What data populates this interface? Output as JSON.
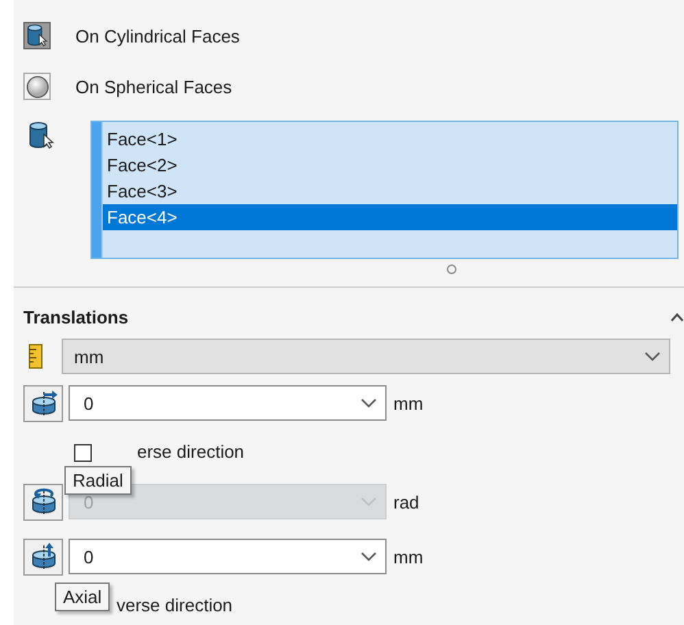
{
  "selection_types": [
    {
      "label": "On Cylindrical Faces",
      "kind": "cylinder",
      "selected": true
    },
    {
      "label": "On Spherical Faces",
      "kind": "sphere",
      "selected": false
    }
  ],
  "faces": [
    {
      "label": "Face<1>",
      "selected": false
    },
    {
      "label": "Face<2>",
      "selected": false
    },
    {
      "label": "Face<3>",
      "selected": false
    },
    {
      "label": "Face<4>",
      "selected": true
    }
  ],
  "translations": {
    "title": "Translations",
    "expanded": true,
    "unit": "mm",
    "controls": [
      {
        "kind": "radial",
        "value": "0",
        "unit": "mm",
        "disabled": false
      },
      {
        "kind": "checkbox",
        "label": "erse direction",
        "checked": false,
        "tooltip": "Radial"
      },
      {
        "kind": "angular",
        "value": "0",
        "unit": "rad",
        "disabled": true
      },
      {
        "kind": "axial",
        "value": "0",
        "unit": "mm",
        "disabled": false
      },
      {
        "kind": "checkbox",
        "label": "verse direction",
        "tooltip": "Axial"
      }
    ]
  }
}
